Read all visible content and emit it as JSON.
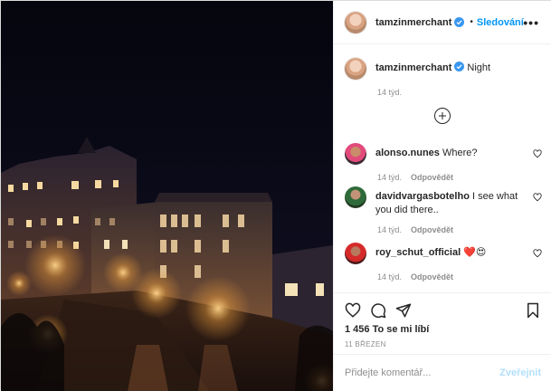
{
  "post": {
    "author": "tamzinmerchant",
    "follow_label": "Sledování",
    "separator": "•",
    "more_label": "•••",
    "caption_text": "Night",
    "caption_age": "14 týd.",
    "likes_text": "1 456 To se mi líbí",
    "date_text": "11 BŘEZEN"
  },
  "comments": [
    {
      "user": "alonso.nunes",
      "text": "Where?",
      "age": "14 týd.",
      "reply_label": "Odpovědět"
    },
    {
      "user": "davidvargasbotelho",
      "text": "I see what you did there..",
      "age": "14 týd.",
      "reply_label": "Odpovědět"
    },
    {
      "user": "roy_schut_official",
      "text": "❤️😍",
      "age": "14 týd.",
      "reply_label": "Odpovědět"
    }
  ],
  "composer": {
    "placeholder": "Přidejte komentář...",
    "post_label": "Zveřejnit"
  },
  "colors": {
    "accent": "#0095f6",
    "verified": "#3897f0",
    "muted": "#8e8e8e",
    "post_disabled": "#b2dffc"
  },
  "icons": {
    "header_avatar": "profile-avatar",
    "verified": "verified-badge-icon",
    "load_more": "plus-circle-icon",
    "like": "heart-icon",
    "comment": "comment-bubble-icon",
    "share": "paper-plane-icon",
    "save": "bookmark-icon"
  }
}
